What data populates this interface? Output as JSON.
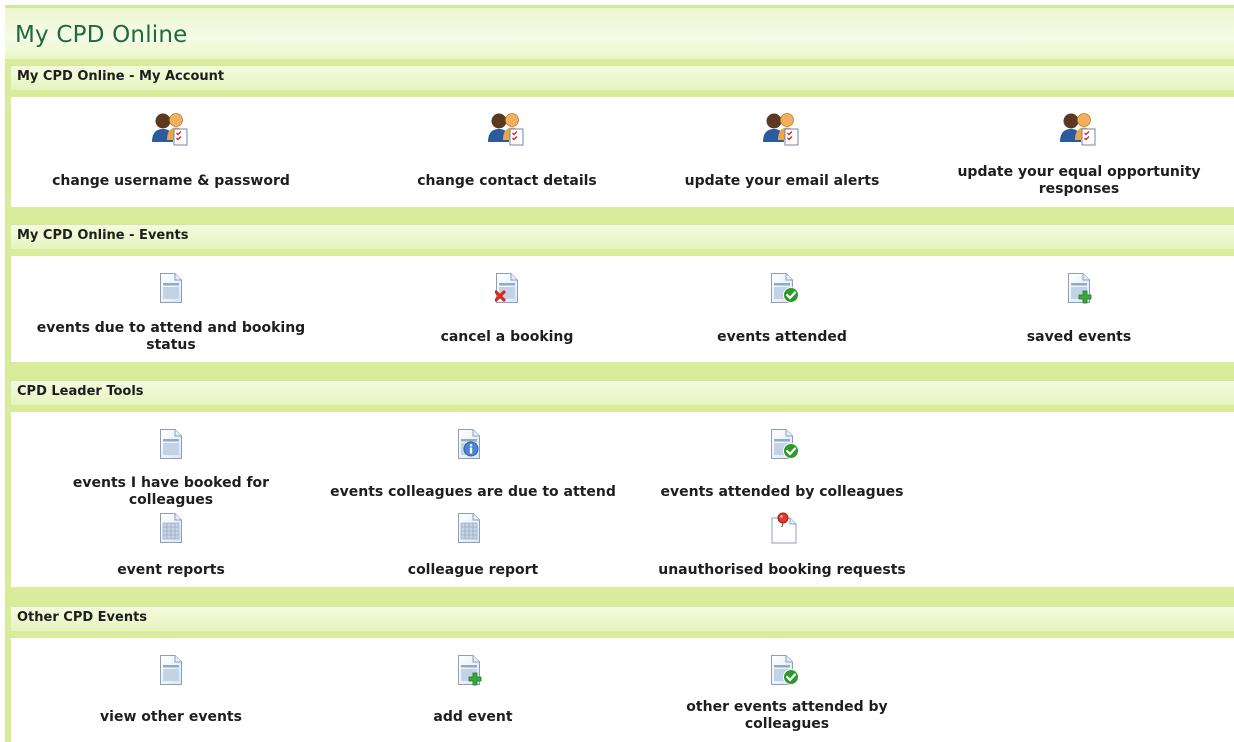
{
  "page_title": "My CPD Online",
  "sections": [
    {
      "header": "My CPD Online - My Account",
      "items": [
        {
          "label": "change username & password",
          "icon": "users-checklist-icon"
        },
        {
          "label": "change contact details",
          "icon": "users-checklist-icon"
        },
        {
          "label": "update your email alerts",
          "icon": "users-checklist-icon"
        },
        {
          "label": "update your equal opportunity responses",
          "icon": "users-checklist-icon"
        }
      ]
    },
    {
      "header": "My CPD Online - Events",
      "items": [
        {
          "label": "events due to attend and booking status",
          "icon": "document-icon"
        },
        {
          "label": "cancel a booking",
          "icon": "document-delete-icon"
        },
        {
          "label": "events attended",
          "icon": "document-check-icon"
        },
        {
          "label": "saved events",
          "icon": "document-add-icon"
        }
      ]
    },
    {
      "header": "CPD Leader Tools",
      "items": [
        {
          "label": "events I have booked for colleagues",
          "icon": "document-icon"
        },
        {
          "label": "events colleagues are due to attend",
          "icon": "document-info-icon"
        },
        {
          "label": "events attended by colleagues",
          "icon": "document-check-icon"
        },
        {
          "label": "event reports",
          "icon": "spreadsheet-icon"
        },
        {
          "label": "colleague report",
          "icon": "spreadsheet-icon"
        },
        {
          "label": "unauthorised booking requests",
          "icon": "pinned-note-icon"
        }
      ]
    },
    {
      "header": "Other CPD Events",
      "items": [
        {
          "label": "view other events",
          "icon": "document-icon"
        },
        {
          "label": "add event",
          "icon": "document-add-icon"
        },
        {
          "label": "other events attended by colleagues",
          "icon": "document-check-icon"
        }
      ]
    }
  ],
  "colors": {
    "frame_green": "#d8ec9c",
    "title_green": "#1d6a3c",
    "check_green": "#2e9a2e",
    "add_green": "#3aa83a",
    "delete_red": "#d62a1e",
    "info_blue": "#2a5fb0"
  }
}
